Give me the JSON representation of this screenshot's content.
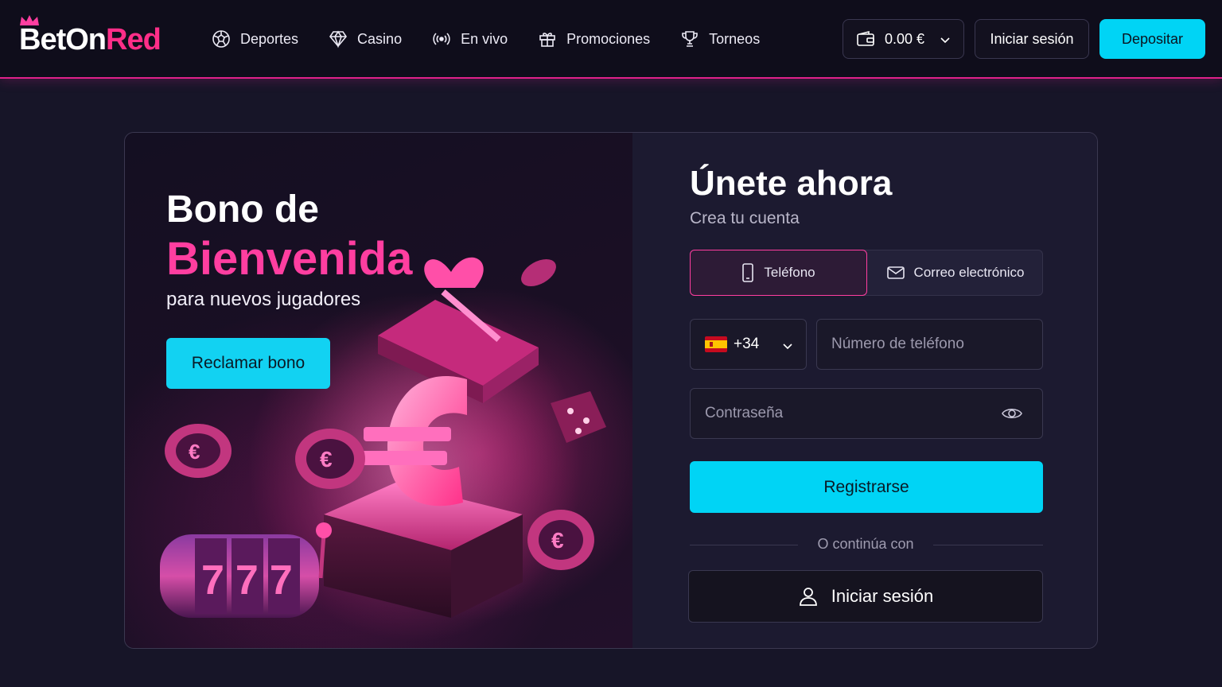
{
  "brand": {
    "name_part1": "BetOn",
    "name_part2": "Red",
    "logo_icon": "crown-icon",
    "accent_pink": "#ff3ea0",
    "accent_cyan": "#00d4f5"
  },
  "nav": {
    "items": [
      {
        "label": "Deportes",
        "icon": "soccer-ball-icon"
      },
      {
        "label": "Casino",
        "icon": "diamond-icon"
      },
      {
        "label": "En vivo",
        "icon": "live-broadcast-icon"
      },
      {
        "label": "Promociones",
        "icon": "gift-icon"
      },
      {
        "label": "Torneos",
        "icon": "trophy-icon"
      }
    ]
  },
  "header": {
    "balance": "0.00 €",
    "login_label": "Iniciar sesión",
    "deposit_label": "Depositar"
  },
  "promo": {
    "title_line1": "Bono de",
    "title_line2": "Bienvenida",
    "subtitle": "para nuevos jugadores",
    "cta_label": "Reclamar bono",
    "slot_digits": "777"
  },
  "signup": {
    "title": "Únete ahora",
    "subtitle": "Crea tu cuenta",
    "tabs": [
      {
        "label": "Teléfono",
        "icon": "phone-icon",
        "active": true
      },
      {
        "label": "Correo electrónico",
        "icon": "mail-icon",
        "active": false
      }
    ],
    "country_code": "+34",
    "phone_placeholder": "Número de teléfono",
    "password_placeholder": "Contraseña",
    "register_label": "Registrarse",
    "divider_text": "O continúa con",
    "alt_login_label": "Iniciar sesión"
  }
}
